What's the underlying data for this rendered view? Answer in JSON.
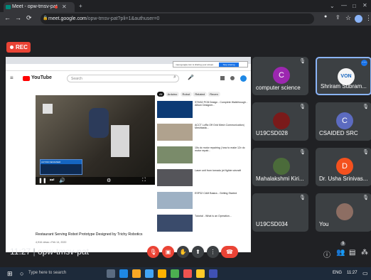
{
  "browser": {
    "tab_title": "Meet - opw-tmsv-pat",
    "url_host": "meet.google.com",
    "url_rest": "/opw-tmsv-pat?pli=1&authuser=0"
  },
  "rec_label": "REC",
  "shared_screen": {
    "popup_text": "meet.google.com is sharing your screen.",
    "stop_label": "Stop sharing",
    "yt_logo": "YouTube",
    "search_placeholder": "Search",
    "video_title": "Restaurant Serving Robot Prototype Designed by Trichy Robotics",
    "video_info": "4,916 views • Feb 14, 2020",
    "overlay_caption": "AUTOM DESIGNER",
    "chips": [
      "All",
      "Arduino",
      "Robot",
      "Related",
      "Recen"
    ],
    "suggestions": [
      {
        "title": "STM32 PCB Design - Complete Walkthrough - Altium Designer...",
        "meta": "Phil's Lab"
      },
      {
        "title": "ACCT LoRa Off Grid Mesh Communication| Meshtastic...",
        "meta": "CNX Software"
      },
      {
        "title": "10s dc motor repairing | how to make 12v dc motor repair...",
        "meta": "Electrical Technical"
      },
      {
        "title": "Laser unit from tornado jet fighter aircraft",
        "meta": "Adventure world"
      },
      {
        "title": "ESP32 CAM Basics - Getting Started",
        "meta": "DroneBot Workshop"
      },
      {
        "title": "Tutorial - What is an Operation...",
        "meta": "Ed Lang"
      }
    ]
  },
  "tiles": [
    {
      "name": "computer science",
      "initial": "C",
      "color": "#9c27b0"
    },
    {
      "name": "Shriram Subram...",
      "initial": "VON",
      "color": "#f5f5f5"
    },
    {
      "name": "U19CSD028",
      "initial": "",
      "color": ""
    },
    {
      "name": "CSAIDED SRC",
      "initial": "C",
      "color": "#5c6bc0"
    },
    {
      "name": "Mahalakshmi Kiri...",
      "initial": "",
      "color": ""
    },
    {
      "name": "Dr. Usha Srinivas...",
      "initial": "D",
      "color": "#f4511e"
    },
    {
      "name": "U19CSD034",
      "initial": "",
      "color": ""
    },
    {
      "name": "You",
      "initial": "",
      "color": ""
    }
  ],
  "meeting": {
    "time": "11:27",
    "separator": "|",
    "code": "opw-tmsv-pat",
    "participants": "9"
  },
  "taskbar": {
    "search_placeholder": "Type here to search",
    "time": "11:27",
    "lang": "ENG"
  }
}
